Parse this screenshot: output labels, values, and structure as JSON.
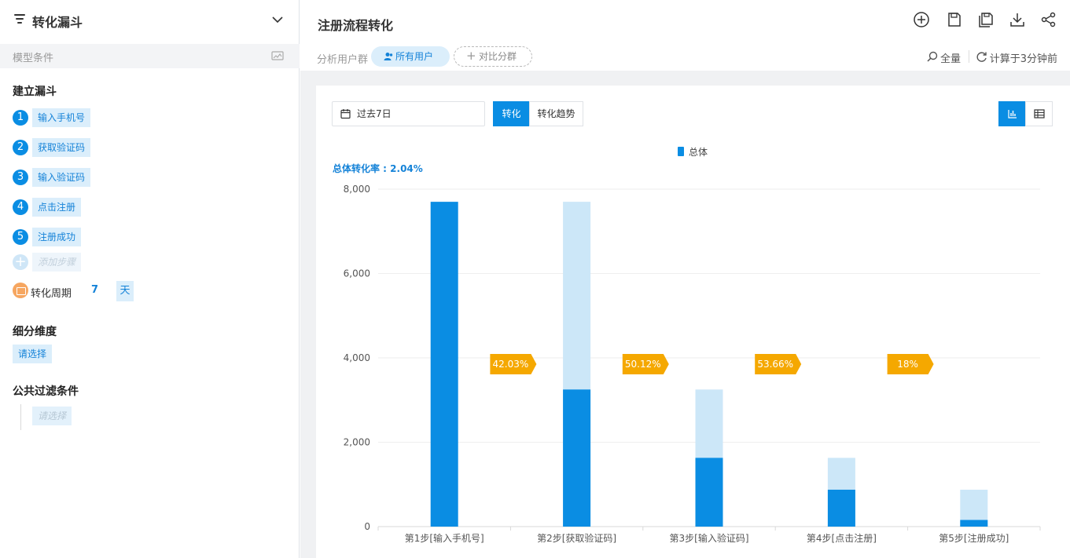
{
  "sidebar": {
    "title": "转化漏斗",
    "model_label": "模型条件",
    "build_title": "建立漏斗",
    "steps": [
      {
        "num": "1",
        "label": "输入手机号"
      },
      {
        "num": "2",
        "label": "获取验证码"
      },
      {
        "num": "3",
        "label": "输入验证码"
      },
      {
        "num": "4",
        "label": "点击注册"
      },
      {
        "num": "5",
        "label": "注册成功"
      }
    ],
    "add_step": "添加步骤",
    "cycle_label": "转化周期",
    "cycle_value": "7",
    "cycle_unit": "天",
    "breakdown_title": "细分维度",
    "breakdown_select": "请选择",
    "filter_title": "公共过滤条件",
    "filter_select": "请选择"
  },
  "header": {
    "title": "注册流程转化",
    "segment_label": "分析用户群",
    "segment_all": "所有用户",
    "segment_compare": "对比分群",
    "sample": "全量",
    "computed": "计算于3分钟前",
    "icons": [
      "add-icon",
      "save-icon",
      "save-as-icon",
      "download-icon",
      "share-icon"
    ]
  },
  "toolbar": {
    "date_range": "过去7日",
    "tab_conversion": "转化",
    "tab_trend": "转化趋势",
    "view_chart_icon": "bar-chart-icon",
    "view_table_icon": "table-icon"
  },
  "chart_data": {
    "type": "bar",
    "legend": [
      "总体"
    ],
    "overall_rate_label": "总体转化率 : 2.04%",
    "categories": [
      "第1步[输入手机号]",
      "第2步[获取验证码]",
      "第3步[输入验证码]",
      "第4步[点击注册]",
      "第5步[注册成功]"
    ],
    "series": [
      {
        "name": "总体",
        "values": [
          7700,
          3250,
          1630,
          875,
          158
        ]
      }
    ],
    "previous_step_values": [
      null,
      7700,
      3250,
      1630,
      875
    ],
    "step_rates": [
      "42.03%",
      "50.12%",
      "53.66%",
      "18%"
    ],
    "ylim": [
      0,
      8000
    ],
    "yticks": [
      "0",
      "2,000",
      "4,000",
      "6,000",
      "8,000"
    ],
    "ytick_values": [
      0,
      2000,
      4000,
      6000,
      8000
    ],
    "grid": true,
    "colors": {
      "primary": "#0a8de3",
      "light": "#cce7f8",
      "badge": "#f5a800"
    }
  }
}
